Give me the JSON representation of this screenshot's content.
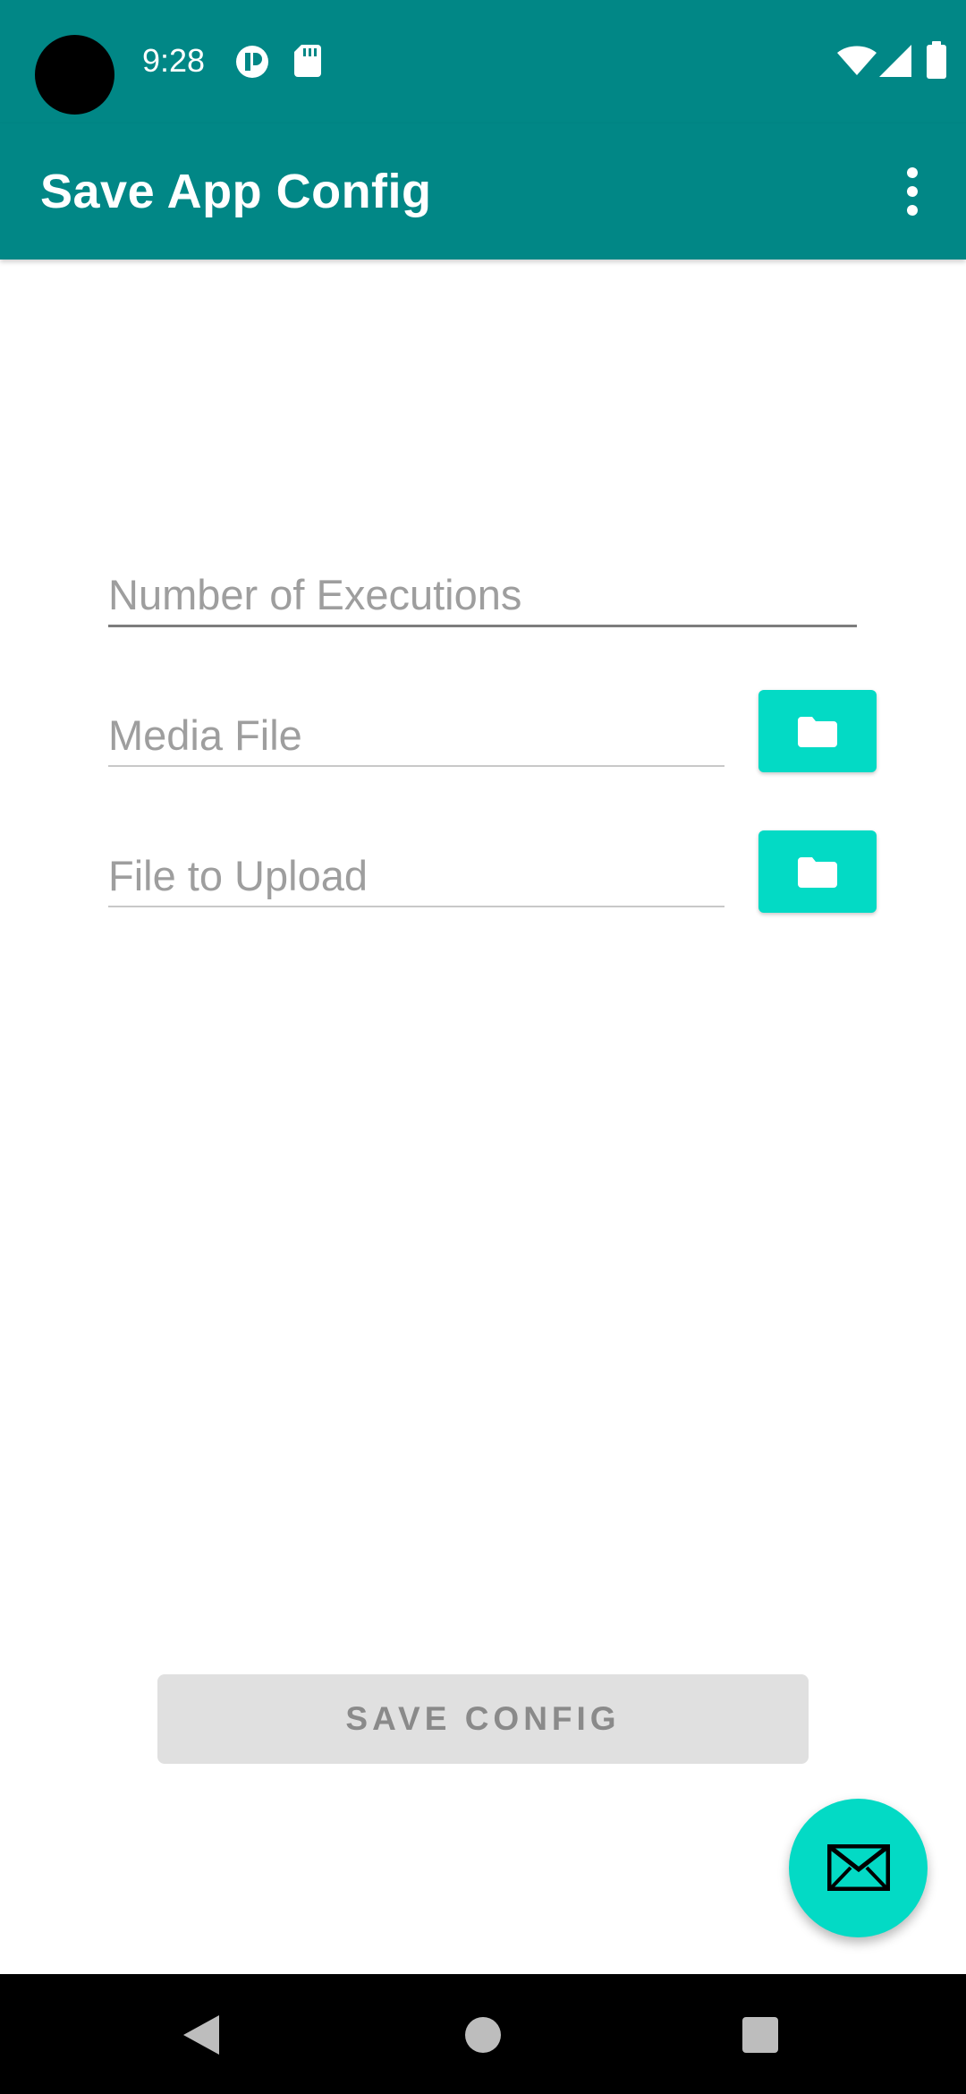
{
  "status_bar": {
    "time": "9:28",
    "icons": [
      "camera-cutout",
      "notification-icon",
      "sd-card-icon",
      "wifi-icon",
      "signal-icon",
      "battery-icon"
    ]
  },
  "app_bar": {
    "title": "Save App Config",
    "overflow_icon": "more-vert-icon"
  },
  "form": {
    "executions_placeholder": "Number of Executions",
    "media_file_placeholder": "Media File",
    "upload_file_placeholder": "File to Upload",
    "folder_icon": "folder-icon"
  },
  "save_button_label": "SAVE CONFIG",
  "fab_icon": "email-icon",
  "nav_bar": {
    "icons": [
      "back-icon",
      "home-icon",
      "recents-icon"
    ]
  },
  "colors": {
    "primary": "#018786",
    "accent": "#03dac5",
    "disabled_button": "#e0e0e0"
  }
}
